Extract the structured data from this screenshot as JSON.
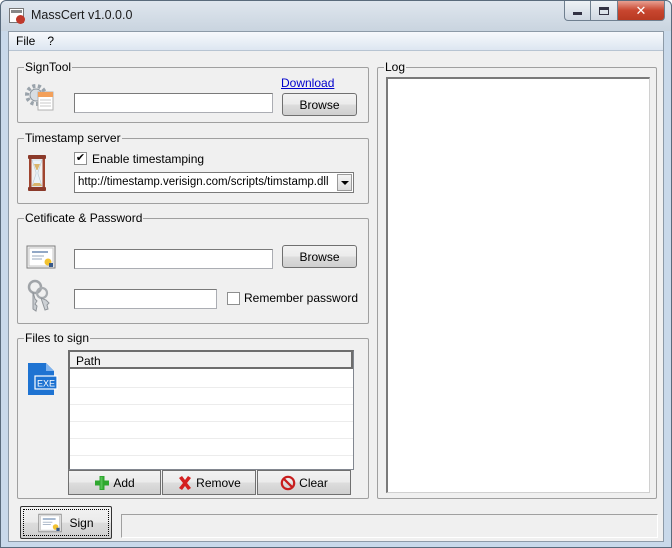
{
  "window": {
    "title": "MassCert v1.0.0.0",
    "controls": {
      "minimize": "minimize",
      "maximize": "maximize",
      "close": "✕"
    }
  },
  "menu": [
    {
      "label": "File"
    },
    {
      "label": "?"
    }
  ],
  "signtool": {
    "legend": "SignTool",
    "download_link": "Download",
    "path_value": "",
    "browse_label": "Browse"
  },
  "timestamp": {
    "legend": "Timestamp server",
    "enable_label": "Enable timestamping",
    "enable_checked": true,
    "check_glyph": "✔",
    "server_url": "http://timestamp.verisign.com/scripts/timstamp.dll"
  },
  "certificate": {
    "legend": "Cetificate & Password",
    "cert_path_value": "",
    "browse_label": "Browse",
    "password_value": "",
    "remember_label": "Remember password",
    "remember_checked": false
  },
  "files": {
    "legend": "Files to sign",
    "columns": [
      "Path"
    ],
    "rows": [],
    "add_label": "Add",
    "remove_label": "Remove",
    "clear_label": "Clear",
    "exe_badge": "EXE"
  },
  "log": {
    "legend": "Log",
    "content": ""
  },
  "footer": {
    "sign_label": "Sign",
    "status_text": ""
  },
  "colors": {
    "link": "#0000cc",
    "close_button": "#c8462f",
    "exe_icon": "#1e73d2",
    "add_icon": "#2fa82f",
    "remove_icon": "#d42020",
    "clear_icon": "#c81e1e"
  }
}
